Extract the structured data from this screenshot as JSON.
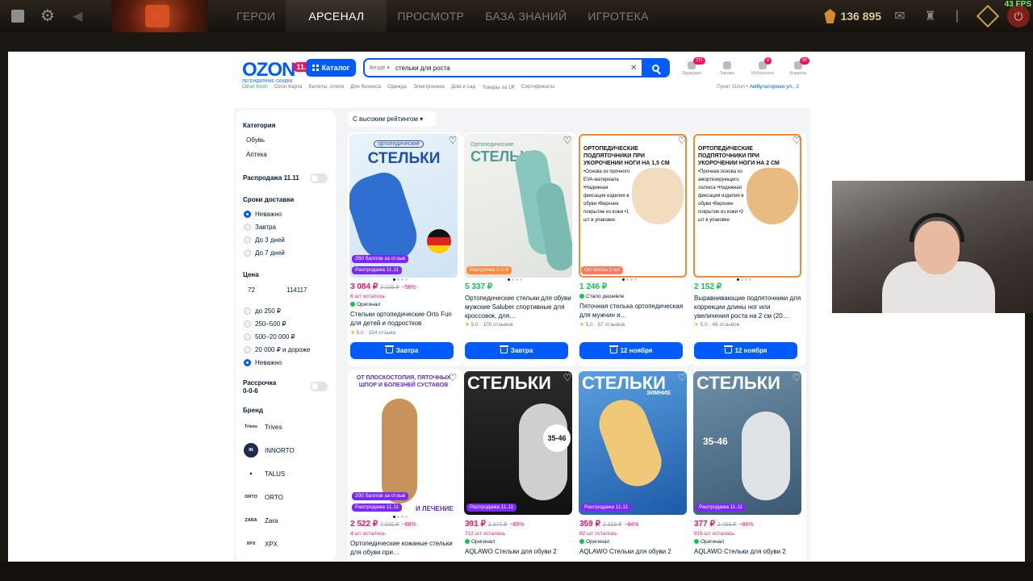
{
  "game_bar": {
    "nav": [
      "ГЕРОИ",
      "АРСЕНАЛ",
      "ПРОСМОТР",
      "БАЗА ЗНАНИЙ",
      "ИГРОТЕКА"
    ],
    "active_nav": "АРСЕНАЛ",
    "shards": "136 895",
    "fps": "43 FPS"
  },
  "ozon": {
    "logo_text": "OZON",
    "logo_badge": "11.11",
    "logo_sub": "ЛЕГЕНДАРНЫЕ СКИДКИ",
    "catalog_label": "Каталог",
    "search_scope": "Везде",
    "search_value": "стельки для роста",
    "actions": [
      {
        "label": "Эдуардас",
        "badge": "271"
      },
      {
        "label": "Заказы",
        "badge": ""
      },
      {
        "label": "Избранное",
        "badge": "9"
      },
      {
        "label": "Корзина",
        "badge": "95"
      }
    ],
    "subnav": [
      "Ozon fresh",
      "Ozon Карта",
      "Билеты, отели",
      "Для бизнеса",
      "Одежда",
      "Электроника",
      "Дом и сад",
      "Товары за 1₽",
      "Сертификаты"
    ],
    "pickup_label": "Пункт Ozon •",
    "pickup_addr": "Амбулаторная ул., 2"
  },
  "filters": {
    "category_title": "Категория",
    "categories": [
      "Обувь",
      "Аптека"
    ],
    "sale_label": "Распродажа 11.11",
    "delivery_title": "Сроки доставки",
    "delivery_options": [
      "Неважно",
      "Завтра",
      "До 3 дней",
      "До 7 дней"
    ],
    "price_title": "Цена",
    "price_from": "72",
    "price_to": "114117",
    "price_ranges": [
      "до 250 ₽",
      "250–500 ₽",
      "500–20 000 ₽",
      "20 000 ₽ и дороже",
      "Неважно"
    ],
    "installment_label": "Рассрочка",
    "installment_sub": "0-0-6",
    "brand_title": "Бренд",
    "brands": [
      "Trives",
      "INNORTO",
      "TALUS",
      "ORTO",
      "Zara",
      "XPX"
    ]
  },
  "sort_label": "С высоким рейтингом",
  "products": [
    {
      "chips": [
        "350 баллов за отзыв",
        "Распродажа 11.11"
      ],
      "price": "3 084 ₽",
      "old": "3 109 ₽",
      "disc": "−56%",
      "stock": "6 шт осталось",
      "tag": "Оригинал",
      "name": "Стельки ортопедические Orto Fun для детей и подростков",
      "rating": "5.0",
      "reviews": "154 отзыва",
      "buy": "Завтра",
      "img_title": "СТЕЛЬКИ",
      "img_sub": "ортопедические"
    },
    {
      "chips": [
        "Рассрочка 0-0-6"
      ],
      "price": "5 337 ₽",
      "old": "",
      "disc": "",
      "stock": "",
      "tag": "",
      "name": "Ортопедические стельки для обуви мужские Saluber спортивные для кроссовок, для…",
      "rating": "5.0",
      "reviews": "105 отзывов",
      "buy": "Завтра",
      "img_title": "СТЕЛЬКИ",
      "img_sub": "Ортопедические"
    },
    {
      "chips": [
        "Осталось 6 шт"
      ],
      "price": "1 246 ₽",
      "old": "",
      "disc": "",
      "stock": "",
      "tag": "Стало дешевле",
      "name": "Пяточная стелька ортопедическая для мужчин и…",
      "rating": "5.0",
      "reviews": "57 отзывов",
      "buy": "12 ноября",
      "img_title": "ОРТОПЕДИЧЕСКИЕ ПОДПЯТОЧНИКИ ПРИ УКОРОЧЕНИИ НОГИ НА 1,5 СМ",
      "img_sub": "•Основа из прочного EVA-материала •Надежная фиксация изделия в обуви •Верхнее покрытие из кожи •1 шт в упаковке"
    },
    {
      "chips": [],
      "price": "2 152 ₽",
      "old": "",
      "disc": "",
      "stock": "",
      "tag": "",
      "name": "Выравнивающие подпяточники для коррекции длины ног или увеличения роста на 2 см (20…",
      "rating": "5.0",
      "reviews": "46 отзывов",
      "buy": "12 ноября",
      "img_title": "ОРТОПЕДИЧЕСКИЕ ПОДПЯТОЧНИКИ ПРИ УКОРОЧЕНИИ НОГИ НА 2 СМ",
      "img_sub": "•Прочная основа из амортизирующего латекса •Надежная фиксация изделия в обуви •Верхнее покрытие из кожи •2 шт в упаковке"
    },
    {
      "chips": [
        "200 баллов за отзыв",
        "Распродажа 11.11"
      ],
      "price": "2 522 ₽",
      "old": "7 500 ₽",
      "disc": "−66%",
      "stock": "4 шт осталось",
      "tag": "",
      "name": "Ортопедические кожаные стельки для обуви при…",
      "rating": "",
      "reviews": "",
      "buy": "",
      "img_title": "ОТ ПЛОСКОСТОПИЯ, ПЯТОЧНЫХ ШПОР И БОЛЕЗНЕЙ СУСТАВОВ",
      "img_sub": "И ЛЕЧЕНИЕ"
    },
    {
      "chips": [
        "Распродажа 11.11"
      ],
      "price": "391 ₽",
      "old": "2 377 ₽",
      "disc": "−85%",
      "stock": "712 шт осталось",
      "tag": "Оригинал",
      "name": "AQLAWO Стельки для обуви 2",
      "rating": "",
      "reviews": "",
      "buy": "",
      "img_title": "СТЕЛЬКИ",
      "img_sub": "35-46"
    },
    {
      "chips": [
        "Распродажа 11.11"
      ],
      "price": "359 ₽",
      "old": "2 333 ₽",
      "disc": "−84%",
      "stock": "62 шт осталось",
      "tag": "Оригинал",
      "name": "AQLAWO Стельки для обуви 2",
      "rating": "",
      "reviews": "",
      "buy": "",
      "img_title": "СТЕЛЬКИ",
      "img_sub": "ЗИМНИЕ"
    },
    {
      "chips": [
        "Распродажа 11.11"
      ],
      "price": "377 ₽",
      "old": "2 488 ₽",
      "disc": "−84%",
      "stock": "916 шт осталось",
      "tag": "Оригинал",
      "name": "AQLAWO Стельки для обуви 2",
      "rating": "",
      "reviews": "",
      "buy": "",
      "img_title": "СТЕЛЬКИ",
      "img_sub": "35-46"
    }
  ]
}
